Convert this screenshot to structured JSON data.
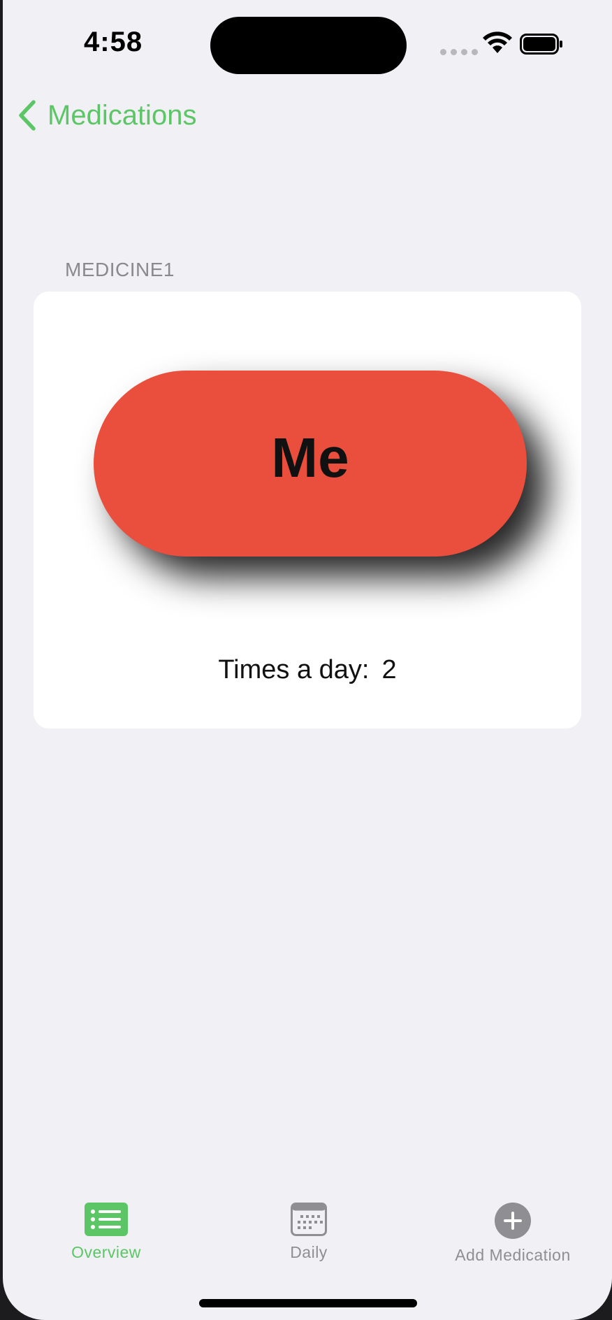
{
  "status_bar": {
    "time": "4:58"
  },
  "nav": {
    "back_label": "Medications"
  },
  "medication": {
    "section_header": "MEDICINE1",
    "pill_label": "Me",
    "pill_color": "#ea4f3d",
    "times_label": "Times a day:",
    "times_value": "2"
  },
  "tab_bar": {
    "accent": "#5cc667",
    "inactive": "#8e8e93",
    "tabs": [
      {
        "label": "Overview",
        "icon": "list-icon",
        "selected": true
      },
      {
        "label": "Daily",
        "icon": "calendar-icon",
        "selected": false
      },
      {
        "label": "Add Medication",
        "icon": "plus-circle-icon",
        "selected": false
      }
    ]
  }
}
